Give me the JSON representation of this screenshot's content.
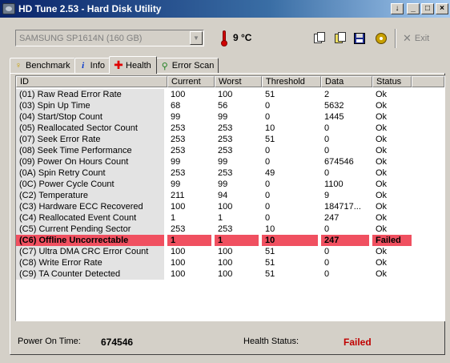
{
  "window": {
    "title": "HD Tune 2.53 - Hard Disk Utility",
    "controls": [
      "↓",
      "_",
      "□",
      "×"
    ]
  },
  "toolbar": {
    "drive": "SAMSUNG SP1614N (160 GB)",
    "temperature": "9 °C",
    "exit_label": "Exit",
    "icons": [
      "copy-text-icon",
      "copy-screenshot-icon",
      "save-icon",
      "options-icon"
    ]
  },
  "tabs": [
    {
      "label": "Benchmark",
      "icon": "bulb-icon",
      "active": false
    },
    {
      "label": "Info",
      "icon": "info-icon",
      "active": false
    },
    {
      "label": "Health",
      "icon": "health-cross-icon",
      "active": true
    },
    {
      "label": "Error Scan",
      "icon": "magnifier-icon",
      "active": false
    }
  ],
  "table": {
    "columns": [
      "ID",
      "Current",
      "Worst",
      "Threshold",
      "Data",
      "Status"
    ],
    "rows": [
      [
        "(01) Raw Read Error Rate",
        "100",
        "100",
        "51",
        "2",
        "Ok"
      ],
      [
        "(03) Spin Up Time",
        "68",
        "56",
        "0",
        "5632",
        "Ok"
      ],
      [
        "(04) Start/Stop Count",
        "99",
        "99",
        "0",
        "1445",
        "Ok"
      ],
      [
        "(05) Reallocated Sector Count",
        "253",
        "253",
        "10",
        "0",
        "Ok"
      ],
      [
        "(07) Seek Error Rate",
        "253",
        "253",
        "51",
        "0",
        "Ok"
      ],
      [
        "(08) Seek Time Performance",
        "253",
        "253",
        "0",
        "0",
        "Ok"
      ],
      [
        "(09) Power On Hours Count",
        "99",
        "99",
        "0",
        "674546",
        "Ok"
      ],
      [
        "(0A) Spin Retry Count",
        "253",
        "253",
        "49",
        "0",
        "Ok"
      ],
      [
        "(0C) Power Cycle Count",
        "99",
        "99",
        "0",
        "1100",
        "Ok"
      ],
      [
        "(C2) Temperature",
        "211",
        "94",
        "0",
        "9",
        "Ok"
      ],
      [
        "(C3) Hardware ECC Recovered",
        "100",
        "100",
        "0",
        "184717...",
        "Ok"
      ],
      [
        "(C4) Reallocated Event Count",
        "1",
        "1",
        "0",
        "247",
        "Ok"
      ],
      [
        "(C5) Current Pending Sector",
        "253",
        "253",
        "10",
        "0",
        "Ok"
      ],
      [
        "(C6) Offline Uncorrectable",
        "1",
        "1",
        "10",
        "247",
        "Failed"
      ],
      [
        "(C7) Ultra DMA CRC Error Count",
        "100",
        "100",
        "51",
        "0",
        "Ok"
      ],
      [
        "(C8) Write Error Rate",
        "100",
        "100",
        "51",
        "0",
        "Ok"
      ],
      [
        "(C9) TA Counter Detected",
        "100",
        "100",
        "51",
        "0",
        "Ok"
      ]
    ],
    "failed_color": "#f05060"
  },
  "status": {
    "power_on_label": "Power On Time:",
    "power_on_value": "674546",
    "health_label": "Health Status:",
    "health_value": "Failed",
    "health_color": "#c00000"
  }
}
